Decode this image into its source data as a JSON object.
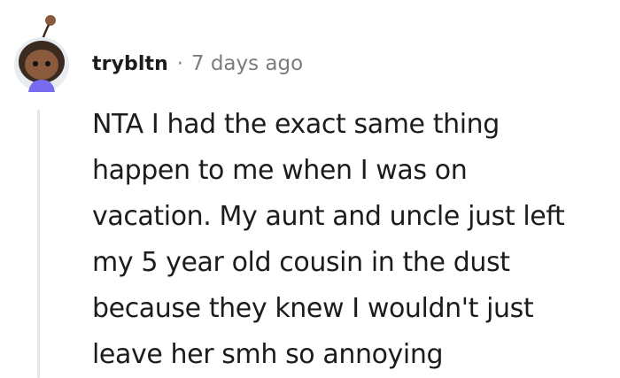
{
  "comment": {
    "author": "trybltn",
    "separator": "·",
    "timestamp": "7 days ago",
    "body_lines": [
      "NTA I had the exact same thing",
      "happen to me when I was on",
      "vacation. My aunt and uncle just left",
      "my 5 year old cousin in the dust",
      "because they knew I wouldn't just",
      "leave her smh so annoying"
    ]
  },
  "colors": {
    "text": "#1c1c1c",
    "meta": "#7c7c7c",
    "thread_line": "#e4e7ea",
    "avatar_bg": "#e9ecef",
    "avatar_skin": "#8a5a3c",
    "avatar_hair": "#3b2a20",
    "avatar_shirt": "#7a6cf0"
  }
}
